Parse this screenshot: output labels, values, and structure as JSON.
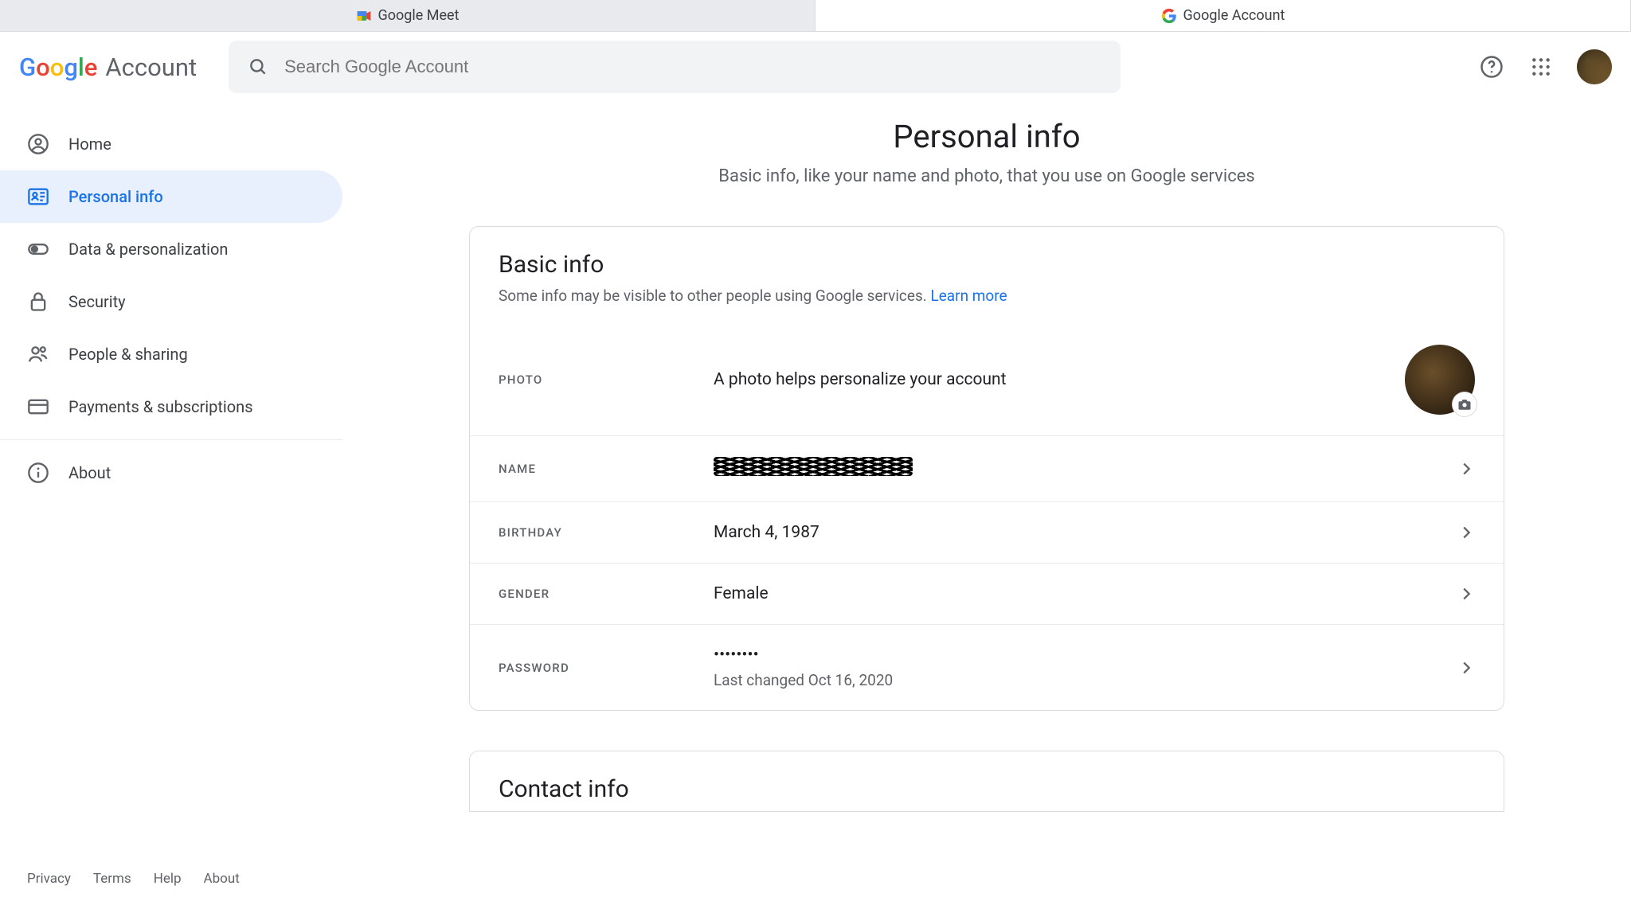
{
  "tabs": [
    {
      "label": "Google Meet"
    },
    {
      "label": "Google Account"
    }
  ],
  "brand": {
    "account_word": "Account"
  },
  "search": {
    "placeholder": "Search Google Account"
  },
  "sidebar": {
    "items": [
      {
        "label": "Home"
      },
      {
        "label": "Personal info"
      },
      {
        "label": "Data & personalization"
      },
      {
        "label": "Security"
      },
      {
        "label": "People & sharing"
      },
      {
        "label": "Payments & subscriptions"
      },
      {
        "label": "About"
      }
    ]
  },
  "footer": {
    "privacy": "Privacy",
    "terms": "Terms",
    "help": "Help",
    "about": "About"
  },
  "page": {
    "title": "Personal info",
    "subtitle": "Basic info, like your name and photo, that you use on Google services"
  },
  "basic": {
    "heading": "Basic info",
    "desc": "Some info may be visible to other people using Google services. ",
    "learn_more": "Learn more",
    "photo_label": "PHOTO",
    "photo_desc": "A photo helps personalize your account",
    "name_label": "NAME",
    "birthday_label": "BIRTHDAY",
    "birthday_value": "March 4, 1987",
    "gender_label": "GENDER",
    "gender_value": "Female",
    "password_label": "PASSWORD",
    "password_value": "••••••••",
    "password_sub": "Last changed Oct 16, 2020"
  },
  "contact": {
    "heading": "Contact info"
  }
}
